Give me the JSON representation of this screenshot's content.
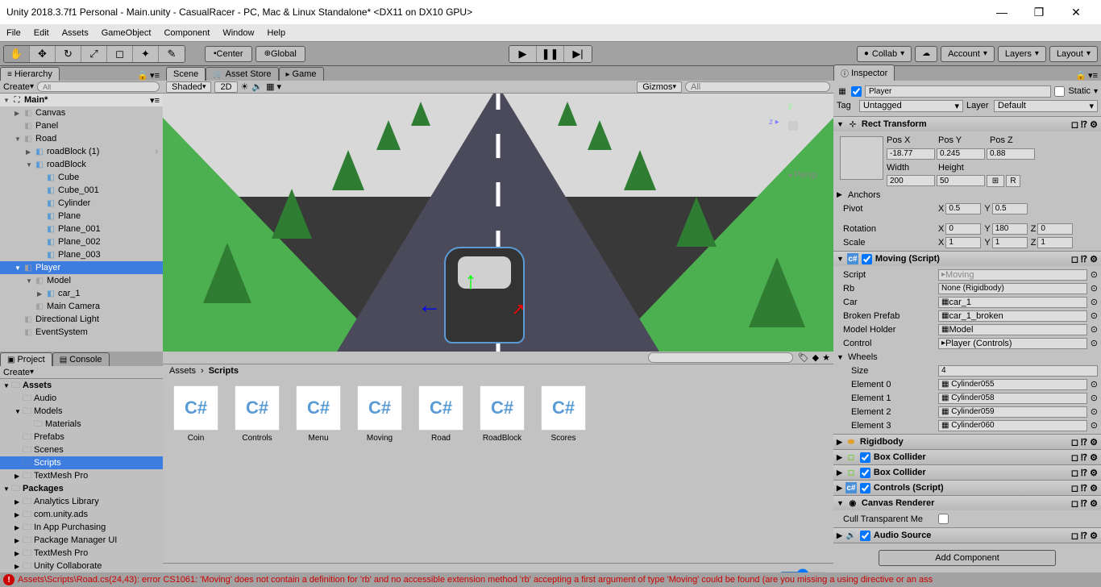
{
  "title": "Unity 2018.3.7f1 Personal - Main.unity - CasualRacer - PC, Mac & Linux Standalone* <DX11 on DX10 GPU>",
  "menubar": [
    "File",
    "Edit",
    "Assets",
    "GameObject",
    "Component",
    "Window",
    "Help"
  ],
  "toolbar": {
    "pivot_mode": "Center",
    "pivot_rotation": "Global",
    "collab": "Collab",
    "account": "Account",
    "layers": "Layers",
    "layout": "Layout"
  },
  "hierarchy": {
    "tab": "Hierarchy",
    "create": "Create",
    "search_placeholder": "All",
    "scene": "Main*",
    "items": [
      {
        "name": "Canvas",
        "indent": 1,
        "type": "go",
        "arrow": "▶"
      },
      {
        "name": "Panel",
        "indent": 1,
        "type": "go"
      },
      {
        "name": "Road",
        "indent": 1,
        "type": "go",
        "arrow": "▼"
      },
      {
        "name": "roadBlock (1)",
        "indent": 2,
        "type": "prefab",
        "arrow": "▶",
        "chevron": true
      },
      {
        "name": "roadBlock",
        "indent": 2,
        "type": "prefab",
        "arrow": "▼"
      },
      {
        "name": "Cube",
        "indent": 3,
        "type": "prefab"
      },
      {
        "name": "Cube_001",
        "indent": 3,
        "type": "prefab"
      },
      {
        "name": "Cylinder",
        "indent": 3,
        "type": "prefab"
      },
      {
        "name": "Plane",
        "indent": 3,
        "type": "prefab"
      },
      {
        "name": "Plane_001",
        "indent": 3,
        "type": "prefab"
      },
      {
        "name": "Plane_002",
        "indent": 3,
        "type": "prefab"
      },
      {
        "name": "Plane_003",
        "indent": 3,
        "type": "prefab"
      },
      {
        "name": "Player",
        "indent": 1,
        "type": "go",
        "arrow": "▼",
        "selected": true
      },
      {
        "name": "Model",
        "indent": 2,
        "type": "go",
        "arrow": "▼"
      },
      {
        "name": "car_1",
        "indent": 3,
        "type": "prefab",
        "arrow": "▶"
      },
      {
        "name": "Main Camera",
        "indent": 2,
        "type": "go"
      },
      {
        "name": "Directional Light",
        "indent": 1,
        "type": "go"
      },
      {
        "name": "EventSystem",
        "indent": 1,
        "type": "go"
      }
    ]
  },
  "scene": {
    "tab_scene": "Scene",
    "tab_asset_store": "Asset Store",
    "tab_game": "Game",
    "shading": "Shaded",
    "mode_2d": "2D",
    "gizmos": "Gizmos",
    "persp": "Persp"
  },
  "project": {
    "tab_project": "Project",
    "tab_console": "Console",
    "create": "Create",
    "folders": [
      {
        "name": "Assets",
        "indent": 0,
        "arrow": "▼",
        "bold": true
      },
      {
        "name": "Audio",
        "indent": 1
      },
      {
        "name": "Models",
        "indent": 1,
        "arrow": "▼"
      },
      {
        "name": "Materials",
        "indent": 2
      },
      {
        "name": "Prefabs",
        "indent": 1
      },
      {
        "name": "Scenes",
        "indent": 1
      },
      {
        "name": "Scripts",
        "indent": 1,
        "selected": true
      },
      {
        "name": "TextMesh Pro",
        "indent": 1,
        "arrow": "▶"
      },
      {
        "name": "Packages",
        "indent": 0,
        "arrow": "▼",
        "bold": true
      },
      {
        "name": "Analytics Library",
        "indent": 1,
        "arrow": "▶"
      },
      {
        "name": "com.unity.ads",
        "indent": 1,
        "arrow": "▶"
      },
      {
        "name": "In App Purchasing",
        "indent": 1,
        "arrow": "▶"
      },
      {
        "name": "Package Manager UI",
        "indent": 1,
        "arrow": "▶"
      },
      {
        "name": "TextMesh Pro",
        "indent": 1,
        "arrow": "▶"
      },
      {
        "name": "Unity Collaborate",
        "indent": 1,
        "arrow": "▶"
      }
    ],
    "breadcrumb": [
      "Assets",
      "Scripts"
    ],
    "assets": [
      "Coin",
      "Controls",
      "Menu",
      "Moving",
      "Road",
      "RoadBlock",
      "Scores"
    ]
  },
  "inspector": {
    "tab": "Inspector",
    "name": "Player",
    "static": "Static",
    "tag_label": "Tag",
    "tag_value": "Untagged",
    "layer_label": "Layer",
    "layer_value": "Default",
    "rect_transform": {
      "title": "Rect Transform",
      "posx_label": "Pos X",
      "posx": "-18.77",
      "posy_label": "Pos Y",
      "posy": "0.245",
      "posz_label": "Pos Z",
      "posz": "0.88",
      "width_label": "Width",
      "width": "200",
      "height_label": "Height",
      "height": "50",
      "anchors": "Anchors",
      "pivot": "Pivot",
      "pivot_x": "0.5",
      "pivot_y": "0.5",
      "rotation": "Rotation",
      "rot_x": "0",
      "rot_y": "180",
      "rot_z": "0",
      "scale": "Scale",
      "scale_x": "1",
      "scale_y": "1",
      "scale_z": "1"
    },
    "moving": {
      "title": "Moving (Script)",
      "script_label": "Script",
      "script": "Moving",
      "rb_label": "Rb",
      "rb": "None (Rigidbody)",
      "car_label": "Car",
      "car": "car_1",
      "broken_label": "Broken Prefab",
      "broken": "car_1_broken",
      "model_label": "Model Holder",
      "model": "Model",
      "control_label": "Control",
      "control": "Player (Controls)",
      "wheels": "Wheels",
      "size_label": "Size",
      "size": "4",
      "elements": [
        {
          "label": "Element 0",
          "value": "Cylinder055"
        },
        {
          "label": "Element 1",
          "value": "Cylinder058"
        },
        {
          "label": "Element 2",
          "value": "Cylinder059"
        },
        {
          "label": "Element 3",
          "value": "Cylinder060"
        }
      ]
    },
    "rigidbody": "Rigidbody",
    "box_collider1": "Box Collider",
    "box_collider2": "Box Collider",
    "controls_script": "Controls (Script)",
    "canvas_renderer": "Canvas Renderer",
    "cull_transparent": "Cull Transparent Me",
    "audio_source": "Audio Source",
    "add_component": "Add Component"
  },
  "error": "Assets\\Scripts\\Road.cs(24,43): error CS1061: 'Moving' does not contain a definition for 'rb' and no accessible extension method 'rb' accepting a first argument of type 'Moving' could be found (are you missing a using directive or an ass"
}
